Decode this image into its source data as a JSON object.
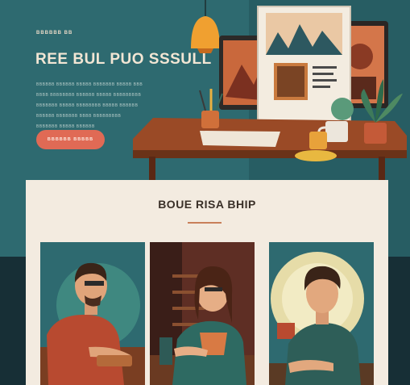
{
  "header": {
    "eyebrow": "BBBBBB BB",
    "title": "REE BUL PUO SSSULL",
    "description_lines": [
      "BBBBBB BBBBBB BBBBB BBBBBBB BBBBB BBB",
      "BBBB BBBBBBBB BBBBBB BBBBB BBBBBBBBB",
      "BBBBBBB BBBBB BBBBBBBB BBBBB BBBBBB",
      "BBBBBB BBBBBBB BBBB BBBBBBBBB",
      "BBBBBBB BBBBB BBBBBB"
    ],
    "cta_label": "BBBBBB  BBBBB"
  },
  "section": {
    "title": "BOUE RISA BHIP"
  },
  "colors": {
    "hero_bg": "#2e6a70",
    "cta": "#e06a55",
    "card_bg": "#f3ebe0",
    "accent": "#c9805a"
  },
  "icons": [
    "pendant-lamp-icon",
    "monitor-icon",
    "plant-icon",
    "coffee-mug-icon"
  ]
}
